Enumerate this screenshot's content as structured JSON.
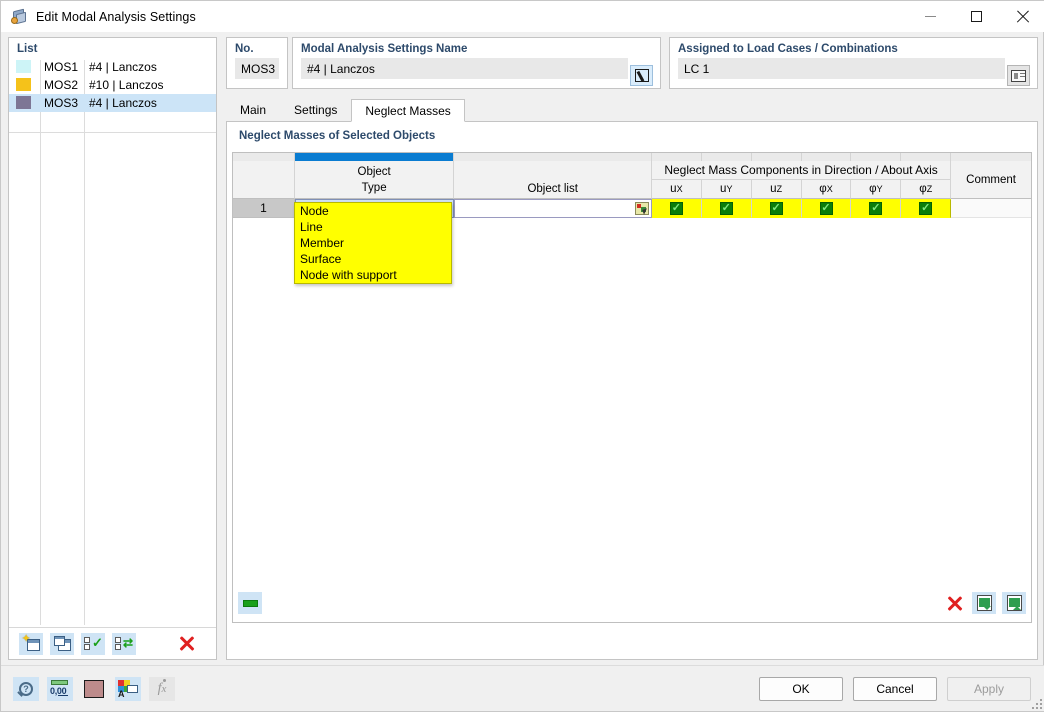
{
  "window": {
    "title": "Edit Modal Analysis Settings",
    "icon": "modal-analysis-icon",
    "minimize": "minimize-icon",
    "maximize": "maximize-icon",
    "close": "close-icon"
  },
  "left_panel": {
    "title": "List",
    "items": [
      {
        "color": "#cdf4f7",
        "id": "MOS1",
        "name": "#4 | Lanczos",
        "selected": false
      },
      {
        "color": "#f5c21a",
        "id": "MOS2",
        "name": "#10 | Lanczos",
        "selected": false
      },
      {
        "color": "#7d7695",
        "id": "MOS3",
        "name": "#4 | Lanczos",
        "selected": true
      }
    ],
    "toolbar": [
      {
        "name": "new-item-button",
        "icon": "new-window-star-icon"
      },
      {
        "name": "copy-item-button",
        "icon": "copy-windows-icon"
      },
      {
        "name": "select-all-button",
        "icon": "checklist-tick-icon"
      },
      {
        "name": "invert-selection-button",
        "icon": "checklist-refresh-icon"
      },
      {
        "name": "delete-item-button",
        "icon": "red-x-icon"
      }
    ]
  },
  "header": {
    "no_label": "No.",
    "no_value": "MOS3",
    "name_label": "Modal Analysis Settings Name",
    "name_value": "#4 | Lanczos",
    "name_edit_icon": "pencil-edit-icon",
    "assigned_label": "Assigned to Load Cases / Combinations",
    "assigned_value": "LC 1",
    "assigned_pick_icon": "load-case-list-icon"
  },
  "tabs": [
    {
      "label": "Main",
      "active": false
    },
    {
      "label": "Settings",
      "active": false
    },
    {
      "label": "Neglect Masses",
      "active": true
    }
  ],
  "content": {
    "section_title": "Neglect Masses of Selected Objects"
  },
  "table": {
    "group_header": "Neglect Mass Components in Direction / About Axis",
    "columns": {
      "row_no": "",
      "object_type_line1": "Object",
      "object_type_line2": "Type",
      "object_list": "Object list",
      "comment": "Comment"
    },
    "axis_columns": [
      {
        "base": "u",
        "sub": "X"
      },
      {
        "base": "u",
        "sub": "Y"
      },
      {
        "base": "u",
        "sub": "Z"
      },
      {
        "base": "φ",
        "sub": "X"
      },
      {
        "base": "φ",
        "sub": "Y"
      },
      {
        "base": "φ",
        "sub": "Z"
      }
    ],
    "rows": [
      {
        "no": "1",
        "object_type": "",
        "object_list": "",
        "checks": [
          true,
          true,
          true,
          true,
          true,
          true
        ],
        "comment": ""
      }
    ],
    "toolbar_left": [
      {
        "name": "table-settings-button",
        "icon": "green-bar-icon"
      }
    ],
    "toolbar_right": [
      {
        "name": "delete-row-button",
        "icon": "red-x-icon"
      },
      {
        "name": "import-excel-button",
        "icon": "excel-import-icon"
      },
      {
        "name": "export-excel-button",
        "icon": "excel-export-icon"
      }
    ]
  },
  "dropdown": {
    "open": true,
    "options": [
      "Node",
      "Line",
      "Member",
      "Surface",
      "Node with support"
    ]
  },
  "bottom_bar": {
    "icons": [
      {
        "name": "help-button",
        "icon": "magnifier-question-icon",
        "disabled": false
      },
      {
        "name": "units-button",
        "icon": "ruler-units-icon",
        "disabled": false
      },
      {
        "name": "color-button",
        "icon": "color-swatch-icon",
        "disabled": false
      },
      {
        "name": "display-properties-button",
        "icon": "legend-color-icon",
        "disabled": false
      },
      {
        "name": "formula-button",
        "icon": "fx-formula-icon",
        "disabled": true
      }
    ],
    "buttons": [
      {
        "label": "OK",
        "name": "ok-button",
        "disabled": false
      },
      {
        "label": "Cancel",
        "name": "cancel-button",
        "disabled": false
      },
      {
        "label": "Apply",
        "name": "apply-button",
        "disabled": true
      }
    ]
  },
  "colors": {
    "accent_blue": "#0a7cd1",
    "header_label": "#2d4a6b",
    "highlight_yellow": "#ffff00",
    "selection_blue": "#cce4f7",
    "check_green": "#0a7d0a"
  }
}
